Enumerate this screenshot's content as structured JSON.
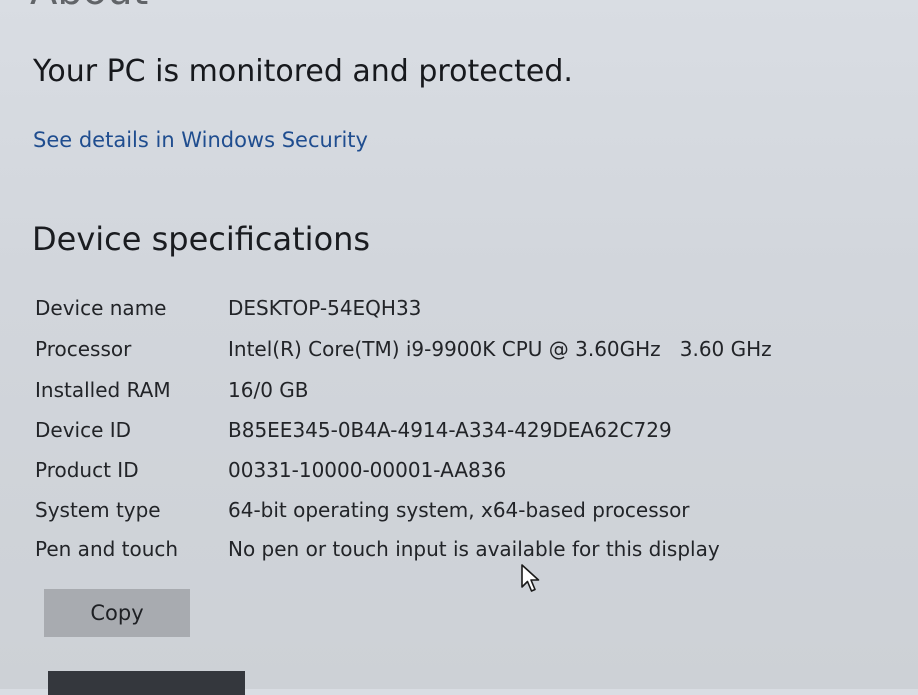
{
  "page": {
    "heading": "About"
  },
  "protection": {
    "status": "Your PC is monitored and protected.",
    "link": "See details in Windows Security"
  },
  "device_specifications": {
    "title": "Device specifications",
    "rows": [
      {
        "label": "Device name",
        "value": "DESKTOP-54EQH33"
      },
      {
        "label": "Processor",
        "value": "Intel(R) Core(TM) i9-9900K CPU @ 3.60GHz   3.60 GHz"
      },
      {
        "label": "Installed RAM",
        "value": "16/0 GB"
      },
      {
        "label": "Device ID",
        "value": "B85EE345-0B4A-4914-A334-429DEA62C729"
      },
      {
        "label": "Product ID",
        "value": "00331-10000-00001-AA836"
      },
      {
        "label": "System type",
        "value": "64-bit operating system, x64-based processor"
      },
      {
        "label": "Pen and touch",
        "value": "No pen or touch input is available for this display"
      }
    ],
    "copy_button": "Copy"
  },
  "icons": {
    "cursor": "mouse-pointer-icon"
  }
}
